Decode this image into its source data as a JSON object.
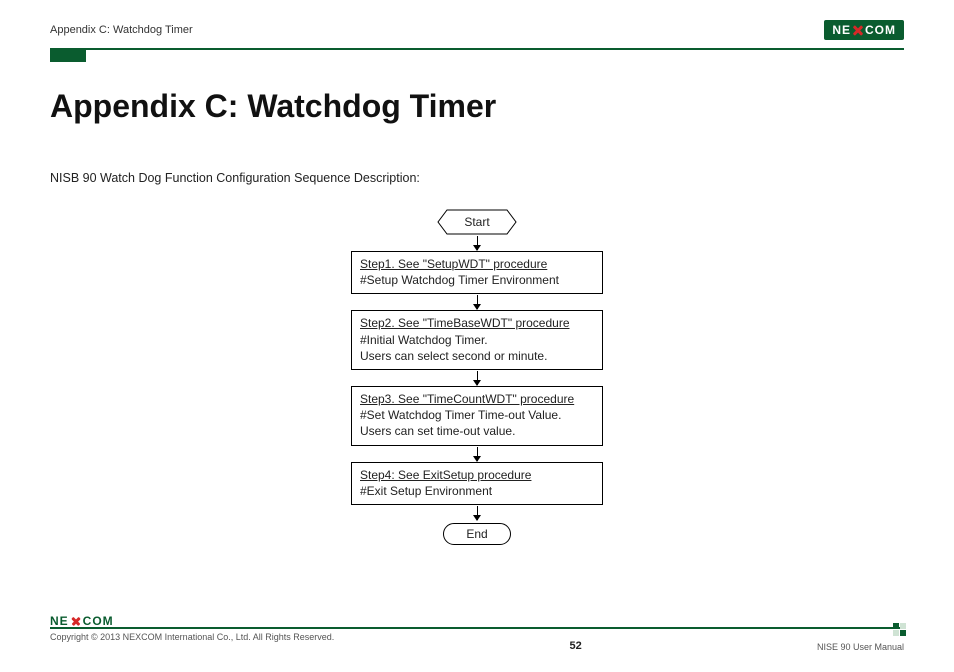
{
  "header": {
    "title": "Appendix C: Watchdog Timer",
    "logo_text_left": "NE",
    "logo_text_right": "COM"
  },
  "page": {
    "title": "Appendix C: Watchdog Timer",
    "intro": "NISB 90 Watch Dog Function Configuration Sequence Description:"
  },
  "flow": {
    "start": "Start",
    "step1_title": "Step1. See \"SetupWDT\" procedure",
    "step1_desc": "#Setup Watchdog Timer Environment",
    "step2_title": "Step2. See \"TimeBaseWDT\" procedure",
    "step2_desc": "#Initial Watchdog Timer.\n Users can select second or minute.",
    "step3_title": "Step3. See \"TimeCountWDT\" procedure",
    "step3_desc": "#Set Watchdog Timer Time-out Value.\nUsers can set time-out value.",
    "step4_title": "Step4: See ExitSetup procedure",
    "step4_desc": "#Exit Setup Environment",
    "end": "End"
  },
  "footer": {
    "logo_text_left": "NE",
    "logo_text_right": "COM",
    "copyright": "Copyright © 2013 NEXCOM International Co., Ltd. All Rights Reserved.",
    "page_number": "52",
    "doc_name": "NISE 90 User Manual"
  }
}
